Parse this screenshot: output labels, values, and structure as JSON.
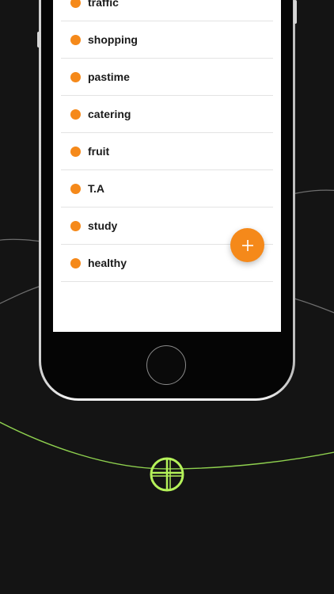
{
  "colors": {
    "background": "#141414",
    "accent": "#f5891a",
    "orbit_green": "#8fd14f",
    "orbit_gray": "#7a7a7a",
    "list_text": "#1a1a1a"
  },
  "categories": [
    {
      "label": "traffic",
      "icon": "orange-dot-icon"
    },
    {
      "label": "shopping",
      "icon": "orange-dot-icon"
    },
    {
      "label": "pastime",
      "icon": "orange-dot-icon"
    },
    {
      "label": "catering",
      "icon": "orange-dot-icon"
    },
    {
      "label": "fruit",
      "icon": "orange-dot-icon"
    },
    {
      "label": "T.A",
      "icon": "orange-dot-icon"
    },
    {
      "label": "study",
      "icon": "orange-dot-icon"
    },
    {
      "label": "healthy",
      "icon": "orange-dot-icon"
    }
  ],
  "fab": {
    "icon": "plus-icon"
  },
  "home_button": {
    "icon": "home-button-icon"
  },
  "decoration": {
    "icon": "crosshair-target-icon"
  }
}
